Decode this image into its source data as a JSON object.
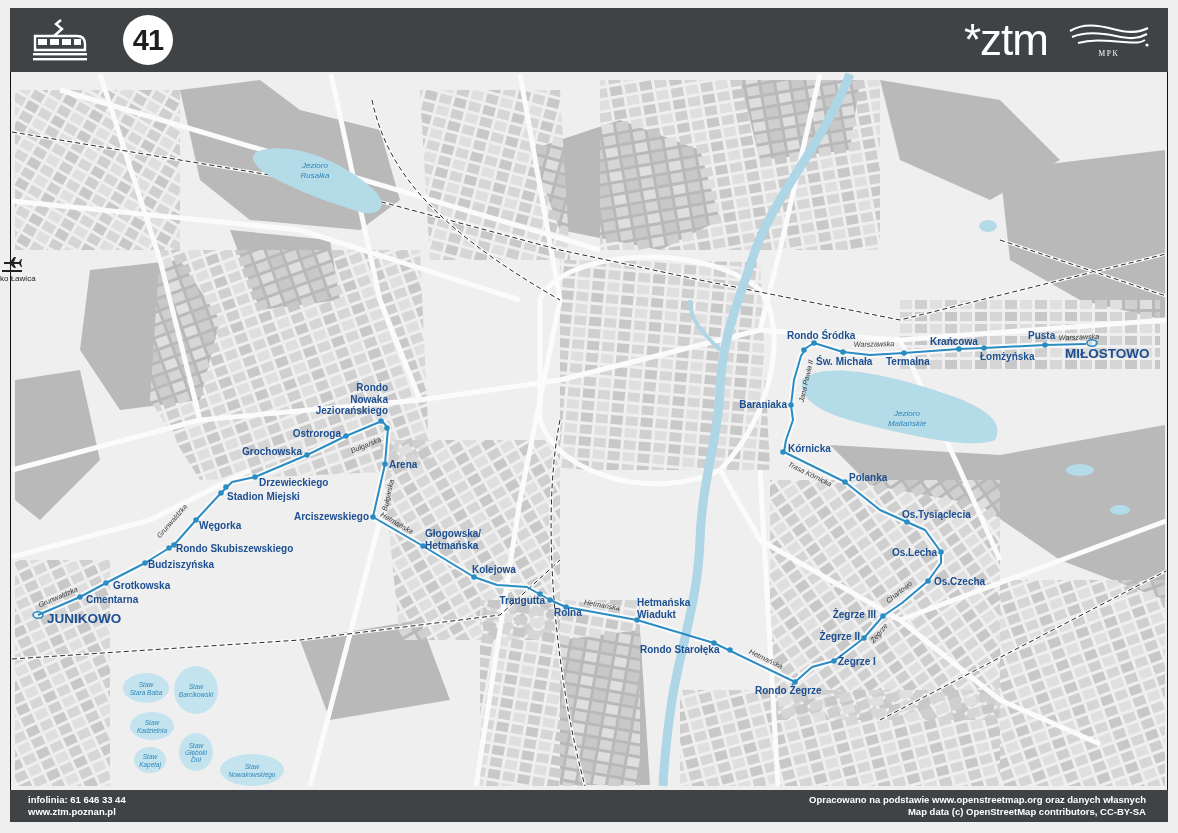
{
  "header": {
    "route_number": "41",
    "logos": [
      {
        "kind": "ztm",
        "text": "*ztm"
      },
      {
        "kind": "mpk",
        "text": "MPK"
      }
    ]
  },
  "map": {
    "airport": {
      "label": "ko Ławica"
    },
    "lakes": [
      {
        "label": "Jezioro\nRusałka"
      },
      {
        "label": "Jezioro\nMaltańskie"
      }
    ],
    "ponds": [
      {
        "label": "Staw\nStara Baba"
      },
      {
        "label": "Staw\nBarcikowski"
      },
      {
        "label": "Staw\nKadzielnia"
      },
      {
        "label": "Staw\nKapelaj"
      },
      {
        "label": "Staw\nGłęboki\nDół"
      },
      {
        "label": "Staw\nNowakowskiego"
      }
    ],
    "streets": [
      {
        "name": "Grunwaldzka"
      },
      {
        "name": "Grunwaldzka"
      },
      {
        "name": "Bułgarska"
      },
      {
        "name": "Bułgarska"
      },
      {
        "name": "Hetmańska"
      },
      {
        "name": "Hetmańska"
      },
      {
        "name": "Hetmańska"
      },
      {
        "name": "Jana Pawła II"
      },
      {
        "name": "Warszawska"
      },
      {
        "name": "Warszawska"
      },
      {
        "name": "Trasa Kórnicka"
      },
      {
        "name": "Chartowo"
      },
      {
        "name": "Żegrze"
      }
    ],
    "stops": [
      {
        "name": "Rondo Śródka",
        "kind": "stop"
      },
      {
        "name": "Św. Michała",
        "kind": "stop"
      },
      {
        "name": "Termalna",
        "kind": "stop"
      },
      {
        "name": "Krańcowa",
        "kind": "stop"
      },
      {
        "name": "Łomżyńska",
        "kind": "stop"
      },
      {
        "name": "Pusta",
        "kind": "stop"
      },
      {
        "name": "MIŁOSTOWO",
        "kind": "terminus"
      },
      {
        "name": "Baraniaka",
        "kind": "stop"
      },
      {
        "name": "Kórnicka",
        "kind": "stop"
      },
      {
        "name": "Polanka",
        "kind": "stop"
      },
      {
        "name": "Os.Tysiąclecia",
        "kind": "stop"
      },
      {
        "name": "Os.Lecha",
        "kind": "stop"
      },
      {
        "name": "Os.Czecha",
        "kind": "stop"
      },
      {
        "name": "Żegrze III",
        "kind": "stop"
      },
      {
        "name": "Żegrze II",
        "kind": "stop"
      },
      {
        "name": "Żegrze I",
        "kind": "stop"
      },
      {
        "name": "Rondo\nNowaka\nJeziorańskiego",
        "kind": "stop"
      },
      {
        "name": "Ostroroga",
        "kind": "stop"
      },
      {
        "name": "Grochowska",
        "kind": "stop"
      },
      {
        "name": "Drzewieckiego",
        "kind": "stop"
      },
      {
        "name": "Stadion Miejski",
        "kind": "stop"
      },
      {
        "name": "Węgorka",
        "kind": "stop"
      },
      {
        "name": "Rondo Skubiszewskiego",
        "kind": "stop"
      },
      {
        "name": "Budziszyńska",
        "kind": "stop"
      },
      {
        "name": "Grotkowska",
        "kind": "stop"
      },
      {
        "name": "Cmentarna",
        "kind": "stop"
      },
      {
        "name": "JUNIKOWO",
        "kind": "terminus"
      },
      {
        "name": "Arena",
        "kind": "stop"
      },
      {
        "name": "Arciszewskiego",
        "kind": "stop"
      },
      {
        "name": "Głogowska/\nHetmańska",
        "kind": "stop"
      },
      {
        "name": "Kolejowa",
        "kind": "stop"
      },
      {
        "name": "Traugutta",
        "kind": "stop"
      },
      {
        "name": "Rolna",
        "kind": "stop"
      },
      {
        "name": "Hetmańska\nWiadukt",
        "kind": "stop"
      },
      {
        "name": "Rondo Starołęka",
        "kind": "stop"
      },
      {
        "name": "Rondo Żegrze",
        "kind": "stop"
      }
    ]
  },
  "footer": {
    "contact": [
      "infolinia: 61 646 33 44",
      "www.ztm.poznan.pl"
    ],
    "credits": [
      "Opracowano na podstawie www.openstreetmap.org oraz danych własnych",
      "Map data (c) OpenStreetMap contributors, CC-BY-SA"
    ]
  }
}
